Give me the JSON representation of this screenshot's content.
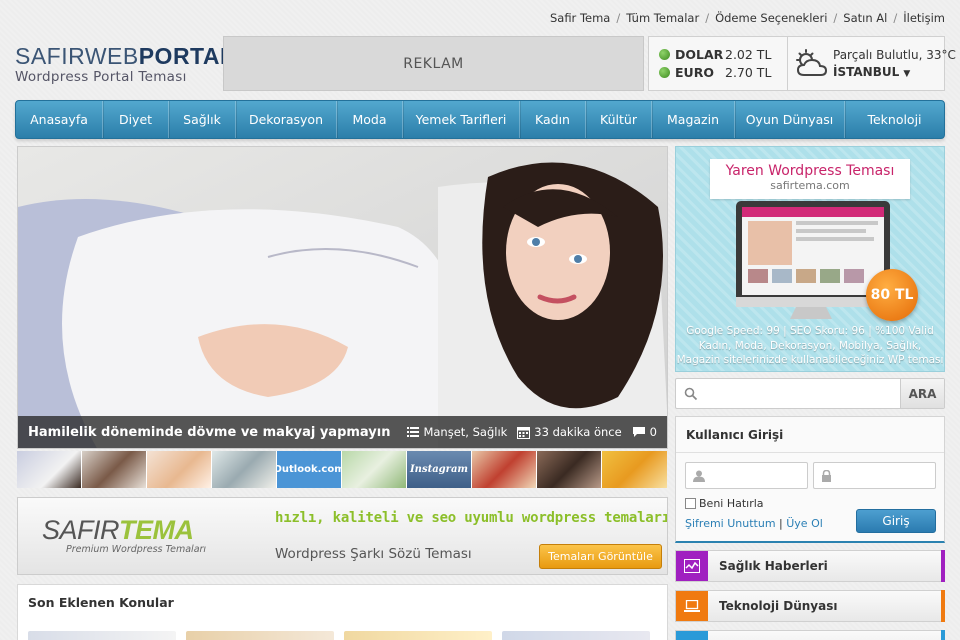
{
  "toplinks": [
    "Safir Tema",
    "Tüm Temalar",
    "Ödeme Seçenekleri",
    "Satın Al",
    "İletişim"
  ],
  "logo": {
    "part1": "SAFIR",
    "part2": "WEB",
    "part3": "PORTAL",
    "subtitle": "Wordpress Portal Teması"
  },
  "ad_label": "REKLAM",
  "currency": [
    {
      "name": "DOLAR",
      "value": "2.02 TL"
    },
    {
      "name": "EURO",
      "value": "2.70 TL"
    }
  ],
  "weather": {
    "condition": "Parçalı Bulutlu, 33°C",
    "city": "İSTANBUL",
    "icon": "partly-cloudy-icon"
  },
  "nav": [
    "Anasayfa",
    "Diyet",
    "Sağlık",
    "Dekorasyon",
    "Moda",
    "Yemek Tarifleri",
    "Kadın",
    "Kültür",
    "Magazin",
    "Oyun Dünyası",
    "Teknoloji"
  ],
  "slider": {
    "title": "Hamilelik döneminde dövme ve makyaj yapmayın",
    "category": "Manşet, Sağlık",
    "time": "33 dakika önce",
    "comments": "0"
  },
  "thumbs": [
    "",
    "",
    "",
    "",
    "Outlook.com",
    "",
    "Instagram",
    "",
    "",
    ""
  ],
  "banner": {
    "logo1": "SAFIR",
    "logo2": "TEMA",
    "logo_sub": "Premium Wordpress Temaları",
    "tagline": "hızlı, kaliteli ve seo uyumlu wordpress temaları",
    "subtitle": "Wordpress Şarkı Sözü Teması",
    "button": "Temaları Görüntüle"
  },
  "recent": {
    "title": "Son Eklenen Konular"
  },
  "right_ad": {
    "title": "Yaren Wordpress Teması",
    "site": "safirtema.com",
    "price": "80 TL",
    "line1": "Google Speed: 99 | SEO Skoru: 96 | %100 Valid",
    "line2": "Kadın, Moda, Dekorasyon, Mobilya, Sağlık,",
    "line3": "Magazin sitelerinizde kullanabileceğiniz WP teması"
  },
  "search": {
    "placeholder": "",
    "button": "ARA"
  },
  "login": {
    "title": "Kullanıcı Girişi",
    "remember": "Beni Hatırla",
    "forgot": "Şifremi Unuttum",
    "sep": " | ",
    "register": "Üye Ol",
    "submit": "Giriş"
  },
  "categories": [
    {
      "label": "Sağlık Haberleri",
      "color": "#a020c0"
    },
    {
      "label": "Teknoloji Dünyası",
      "color": "#f07a10"
    },
    {
      "label": "",
      "color": "#2a9ad8"
    }
  ],
  "colors": {
    "accent": "#2b7eaa",
    "green": "#8cbf2a",
    "orange": "#e89a10"
  }
}
